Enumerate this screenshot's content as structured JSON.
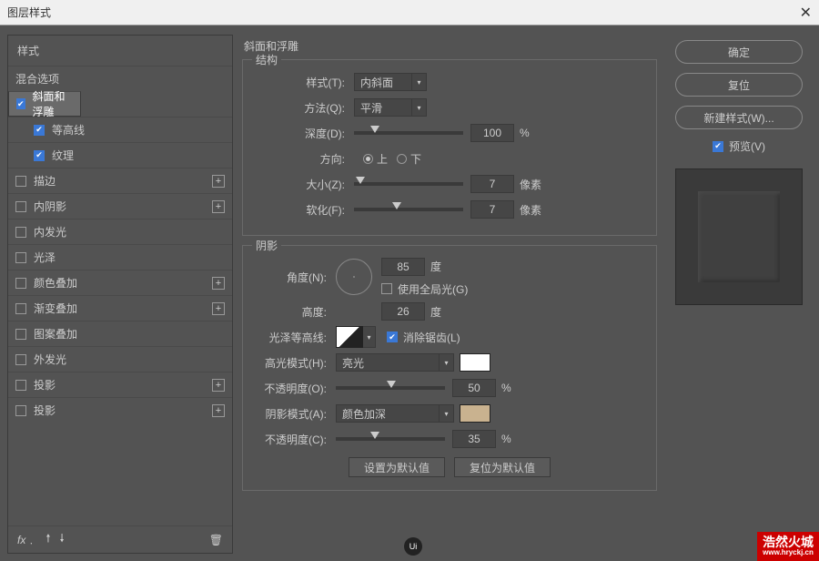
{
  "title": "图层样式",
  "sidebar": {
    "header": "样式",
    "blend": "混合选项",
    "items": [
      {
        "label": "斜面和浮雕",
        "checked": true,
        "selected": true,
        "plus": false,
        "indent": false
      },
      {
        "label": "等高线",
        "checked": true,
        "selected": false,
        "plus": false,
        "indent": true
      },
      {
        "label": "纹理",
        "checked": true,
        "selected": false,
        "plus": false,
        "indent": true
      },
      {
        "label": "描边",
        "checked": false,
        "selected": false,
        "plus": true,
        "indent": false
      },
      {
        "label": "内阴影",
        "checked": false,
        "selected": false,
        "plus": true,
        "indent": false
      },
      {
        "label": "内发光",
        "checked": false,
        "selected": false,
        "plus": false,
        "indent": false
      },
      {
        "label": "光泽",
        "checked": false,
        "selected": false,
        "plus": false,
        "indent": false
      },
      {
        "label": "颜色叠加",
        "checked": false,
        "selected": false,
        "plus": true,
        "indent": false
      },
      {
        "label": "渐变叠加",
        "checked": false,
        "selected": false,
        "plus": true,
        "indent": false
      },
      {
        "label": "图案叠加",
        "checked": false,
        "selected": false,
        "plus": false,
        "indent": false
      },
      {
        "label": "外发光",
        "checked": false,
        "selected": false,
        "plus": false,
        "indent": false
      },
      {
        "label": "投影",
        "checked": false,
        "selected": false,
        "plus": true,
        "indent": false
      },
      {
        "label": "投影",
        "checked": false,
        "selected": false,
        "plus": true,
        "indent": false
      }
    ],
    "fx": "fx"
  },
  "center": {
    "title": "斜面和浮雕",
    "struct_legend": "结构",
    "style_lab": "样式(T):",
    "style_val": "内斜面",
    "tech_lab": "方法(Q):",
    "tech_val": "平滑",
    "depth_lab": "深度(D):",
    "depth_val": "100",
    "pct": "%",
    "dir_lab": "方向:",
    "dir_up": "上",
    "dir_down": "下",
    "size_lab": "大小(Z):",
    "size_val": "7",
    "px": "像素",
    "soften_lab": "软化(F):",
    "soften_val": "7",
    "shade_legend": "阴影",
    "angle_lab": "角度(N):",
    "angle_val": "85",
    "deg": "度",
    "global_lab": "使用全局光(G)",
    "alt_lab": "高度:",
    "alt_val": "26",
    "gloss_lab": "光泽等高线:",
    "aa_lab": "消除锯齿(L)",
    "hl_mode_lab": "高光模式(H):",
    "hl_mode_val": "亮光",
    "hl_color": "#ffffff",
    "hl_op_lab": "不透明度(O):",
    "hl_op_val": "50",
    "sh_mode_lab": "阴影模式(A):",
    "sh_mode_val": "颜色加深",
    "sh_color": "#c9b28f",
    "sh_op_lab": "不透明度(C):",
    "sh_op_val": "35",
    "default_btn": "设置为默认值",
    "reset_btn": "复位为默认值"
  },
  "right": {
    "ok": "确定",
    "cancel": "复位",
    "new_style": "新建样式(W)...",
    "preview": "预览(V)"
  },
  "watermark": {
    "main": "浩然火城",
    "url": "www.hryckj.cn"
  }
}
